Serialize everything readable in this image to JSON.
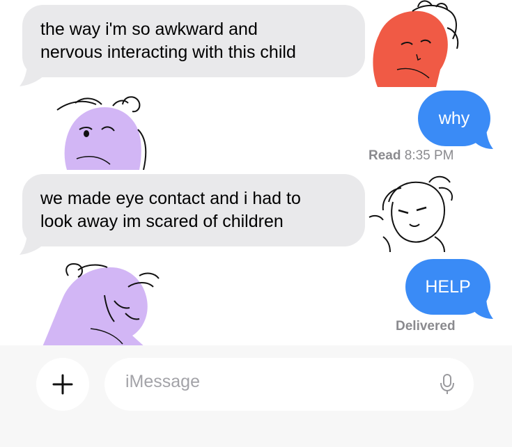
{
  "messages": [
    {
      "direction": "incoming",
      "text_lines": [
        "the way i'm so awkward and",
        "nervous interacting with this child"
      ]
    },
    {
      "direction": "outgoing",
      "text": "why"
    },
    {
      "direction": "incoming",
      "text_lines": [
        "we made eye contact and i had to",
        "look away im scared of children"
      ]
    },
    {
      "direction": "outgoing",
      "text": "HELP"
    }
  ],
  "receipts": {
    "read_label": "Read",
    "read_time": "8:35 PM",
    "delivered": "Delivered"
  },
  "composer": {
    "placeholder": "iMessage",
    "plus_icon": "plus-icon",
    "mic_icon": "microphone-icon"
  },
  "colors": {
    "incoming_bubble": "#e9e9eb",
    "outgoing_bubble": "#3a8bf6",
    "sticker_red": "#f05a45",
    "sticker_purple": "#d2b6f5"
  }
}
